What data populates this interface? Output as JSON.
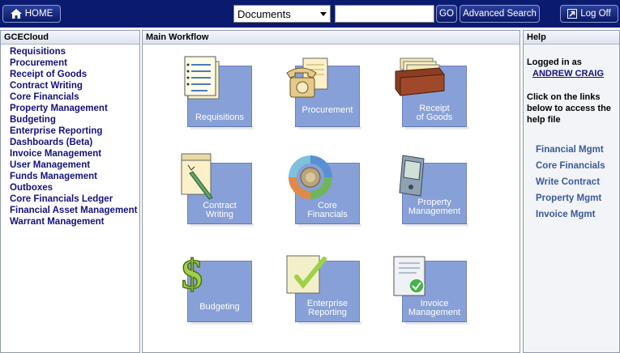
{
  "header": {
    "home_label": "HOME",
    "search_select": "Documents",
    "search_value": "",
    "go_label": "GO",
    "advanced_label": "Advanced Search",
    "logoff_label": "Log Off"
  },
  "left_panel": {
    "title": "GCECloud",
    "items": [
      "Requisitions",
      "Procurement",
      "Receipt of Goods",
      "Contract Writing",
      "Core Financials",
      "Property Management",
      "Budgeting",
      "Enterprise Reporting",
      "Dashboards (Beta)",
      "Invoice Management",
      "User Management",
      "Funds Management",
      "Outboxes",
      "Core Financials Ledger",
      "Financial Asset Management",
      "Warrant Management"
    ]
  },
  "main_panel": {
    "title": "Main Workflow",
    "tiles": [
      {
        "label": "Requisitions",
        "icon": "requisitions-document-icon"
      },
      {
        "label": "Procurement",
        "icon": "telephone-icon"
      },
      {
        "label": "Receipt\nof Goods",
        "icon": "card-file-box-icon"
      },
      {
        "label": "Contract\nWriting",
        "icon": "pen-paper-icon"
      },
      {
        "label": "Core\nFinancials",
        "icon": "cycle-arrows-icon"
      },
      {
        "label": "Property\nManagement",
        "icon": "pda-device-icon"
      },
      {
        "label": "Budgeting",
        "icon": "dollar-sign-icon"
      },
      {
        "label": "Enterprise\nReporting",
        "icon": "checkmark-paper-icon"
      },
      {
        "label": "Invoice\nManagement",
        "icon": "invoice-check-icon"
      }
    ]
  },
  "help_panel": {
    "title": "Help",
    "logged_in_label": "Logged in as",
    "user_name": "ANDREW CRAIG",
    "instruction": "Click on the links below to access the help file",
    "links": [
      "Financial Mgmt",
      "Core Financials",
      "Write Contract",
      "Property Mgmt",
      "Invoice Mgmt"
    ]
  },
  "colors": {
    "topbar": "#0a1a6e",
    "tile": "#87a0d7",
    "nav_link": "#14127a",
    "help_link": "#3b5a98"
  }
}
